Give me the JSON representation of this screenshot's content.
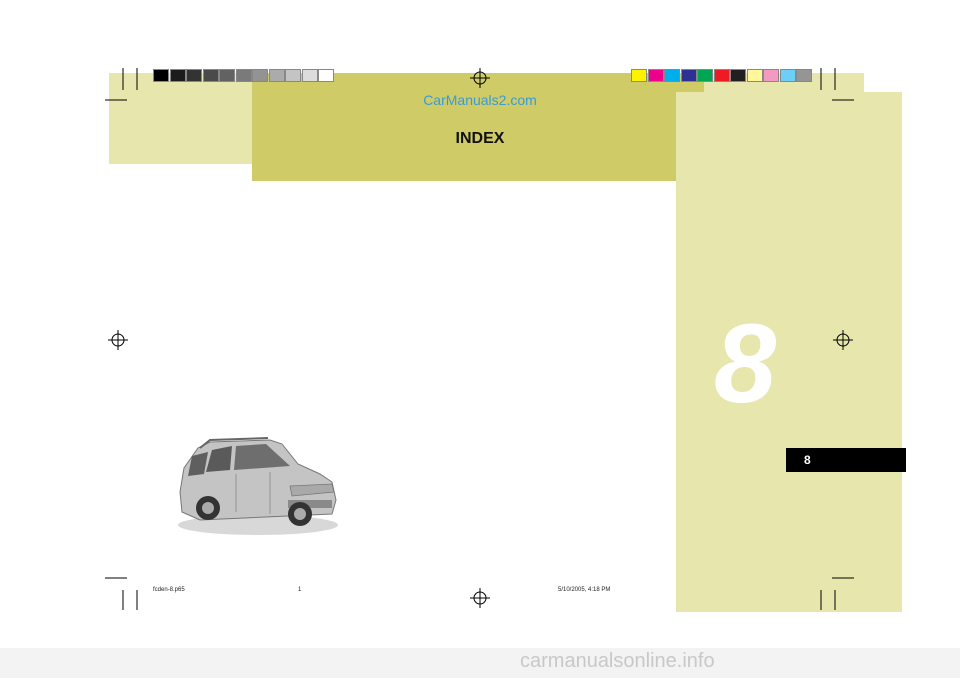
{
  "header": {
    "watermark": "CarManuals2.com",
    "title": "INDEX"
  },
  "chapter": {
    "big_number": "8",
    "tab_number": "8"
  },
  "footer": {
    "filename": "fcden-8.p65",
    "page": "1",
    "timestamp": "5/10/2005, 4:18 PM"
  },
  "bottom_watermark": "carmanualsonline.info",
  "colors": {
    "panel_light": "#e6e6ad",
    "panel_dark": "#cfcb66",
    "watermark_blue": "#3a9bd6"
  },
  "color_bar_left": [
    "#000000",
    "#1c1c1c",
    "#333333",
    "#4a4a4a",
    "#626262",
    "#7a7a7a",
    "#939393",
    "#ababab",
    "#c4c4c4",
    "#dcdcdc",
    "#ffffff"
  ],
  "color_bar_right": [
    "#fff200",
    "#ec008c",
    "#00aeef",
    "#2e3192",
    "#00a651",
    "#ed1c24",
    "#231f20",
    "#fff799",
    "#f49ac1",
    "#6dcff6",
    "#959595"
  ]
}
